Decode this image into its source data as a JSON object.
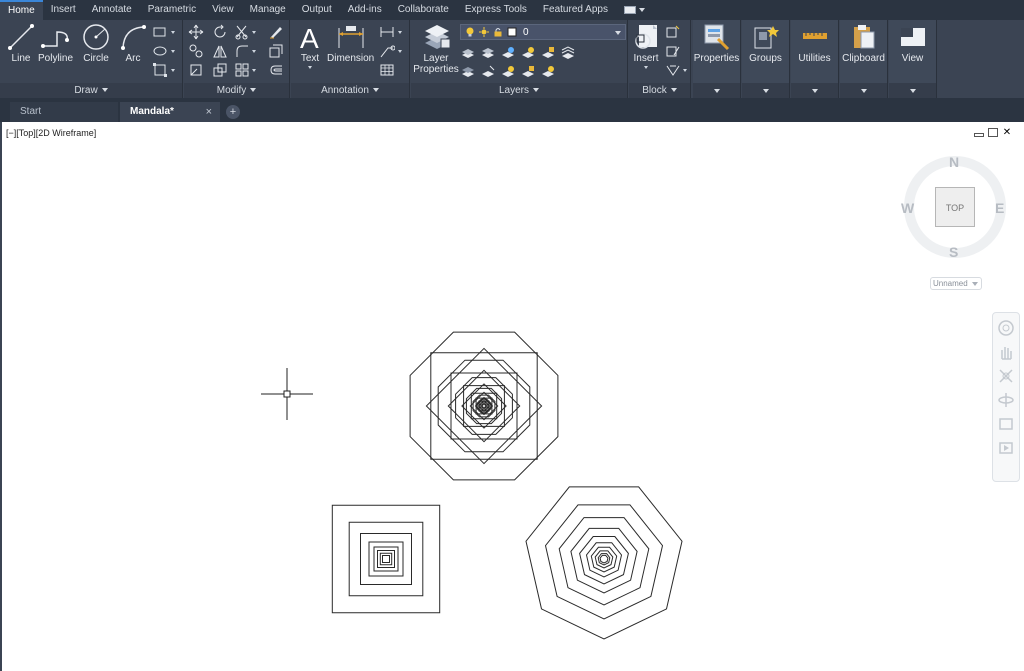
{
  "ribbon_tabs": [
    "Home",
    "Insert",
    "Annotate",
    "Parametric",
    "View",
    "Manage",
    "Output",
    "Add-ins",
    "Collaborate",
    "Express Tools",
    "Featured Apps"
  ],
  "active_tab": "Home",
  "draw": {
    "title": "Draw",
    "line": "Line",
    "polyline": "Polyline",
    "circle": "Circle",
    "arc": "Arc"
  },
  "modify": {
    "title": "Modify"
  },
  "annotation": {
    "title": "Annotation",
    "text": "Text",
    "dimension": "Dimension"
  },
  "layers": {
    "title": "Layers",
    "layer_properties": "Layer Properties",
    "current_layer": "0"
  },
  "block": {
    "title": "Block",
    "insert": "Insert"
  },
  "stacked_panels": {
    "properties": "Properties",
    "groups": "Groups",
    "utilities": "Utilities",
    "clipboard": "Clipboard",
    "view": "View"
  },
  "file_tabs": {
    "start": "Start",
    "current": "Mandala*",
    "close": "×",
    "new": "+"
  },
  "viewport": {
    "label": "[−][Top][2D Wireframe]"
  },
  "viewcube": {
    "face": "TOP",
    "north": "N",
    "south": "S",
    "east": "E",
    "west": "W",
    "wcs": "Unnamed"
  },
  "colors": {
    "ribbon_bg": "#3b4453",
    "tab_bar_bg": "#2b3441",
    "accent": "#3a86d8",
    "canvas_bg": "#ffffff"
  },
  "icons": [
    "line-icon",
    "polyline-icon",
    "circle-icon",
    "arc-icon",
    "text-icon",
    "dimension-icon",
    "layer-properties-icon",
    "insert-icon",
    "properties-icon",
    "groups-icon",
    "utilities-icon",
    "clipboard-icon",
    "view-icon",
    "crosshair-cursor"
  ]
}
